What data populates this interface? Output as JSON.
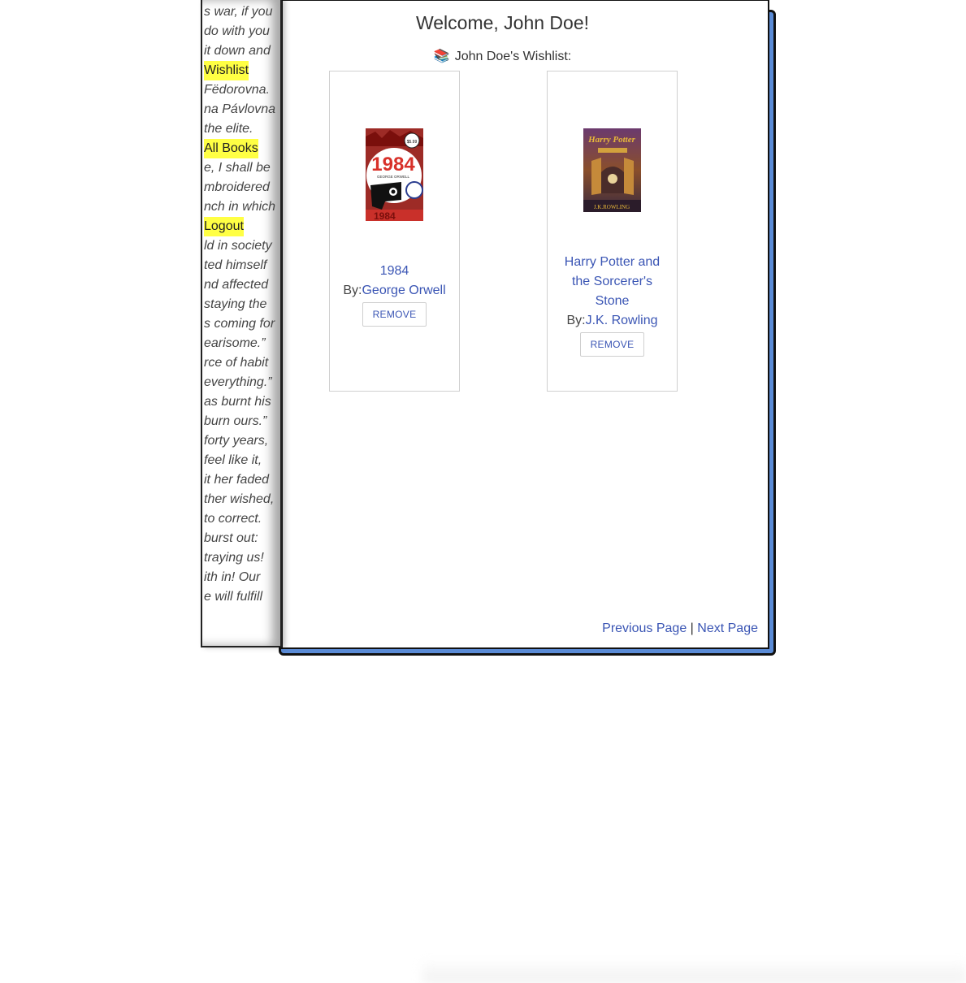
{
  "sidebar": {
    "lines": [
      {
        "text": "s war, if you",
        "nav": false
      },
      {
        "text": "do with you",
        "nav": false
      },
      {
        "text": "it down and",
        "nav": false
      },
      {
        "text": "Wishlist",
        "nav": true
      },
      {
        "text": "Fëdorovna.",
        "nav": false
      },
      {
        "text": "na Pávlovna",
        "nav": false
      },
      {
        "text": "the elite.",
        "nav": false
      },
      {
        "text": "All Books",
        "nav": true
      },
      {
        "text": "e, I shall be",
        "nav": false
      },
      {
        "text": "mbroidered",
        "nav": false
      },
      {
        "text": "nch in which",
        "nav": false
      },
      {
        "text": "Logout",
        "nav": true
      },
      {
        "text": "ld in society",
        "nav": false
      },
      {
        "text": "ted himself",
        "nav": false
      },
      {
        "text": "nd affected",
        "nav": false
      },
      {
        "text": "staying the",
        "nav": false
      },
      {
        "text": "s coming for",
        "nav": false
      },
      {
        "text": "earisome.”",
        "nav": false
      },
      {
        "text": "rce of habit",
        "nav": false
      },
      {
        "text": "everything.”",
        "nav": false
      },
      {
        "text": "as burnt his",
        "nav": false
      },
      {
        "text": "burn ours.”",
        "nav": false
      },
      {
        "text": "forty years,",
        "nav": false
      },
      {
        "text": "feel like it,",
        "nav": false
      },
      {
        "text": "it her faded",
        "nav": false
      },
      {
        "text": "ther wished,",
        "nav": false
      },
      {
        "text": "to correct.",
        "nav": false
      },
      {
        "text": "burst out:",
        "nav": false
      },
      {
        "text": "traying us!",
        "nav": false
      },
      {
        "text": "ith in! Our",
        "nav": false
      },
      {
        "text": "e will fulfill",
        "nav": false
      }
    ]
  },
  "header": {
    "welcome": "Welcome, John Doe!",
    "wishlist_icon": "📚",
    "wishlist_title": "John Doe's Wishlist:"
  },
  "books": [
    {
      "title": "1984",
      "by_label": "By:",
      "author": "George Orwell",
      "remove_label": "REMOVE",
      "cover_icon": "book-cover-1984",
      "cover_text": {
        "price": "$5.99",
        "big": "1984",
        "author": "GEORGE ORWELL"
      }
    },
    {
      "title": "Harry Potter and the Sorcerer's Stone",
      "by_label": "By:",
      "author": "J.K. Rowling",
      "remove_label": "REMOVE",
      "cover_icon": "book-cover-harry-potter",
      "cover_text": {
        "top": "Harry Potter",
        "bottom": "J.K.ROWLING"
      }
    }
  ],
  "pager": {
    "previous": "Previous Page",
    "separator": "|",
    "next": "Next Page"
  },
  "colors": {
    "link": "#3a55b4",
    "highlight": "#ffff44",
    "panel_shadow": "#5a8bd6"
  }
}
